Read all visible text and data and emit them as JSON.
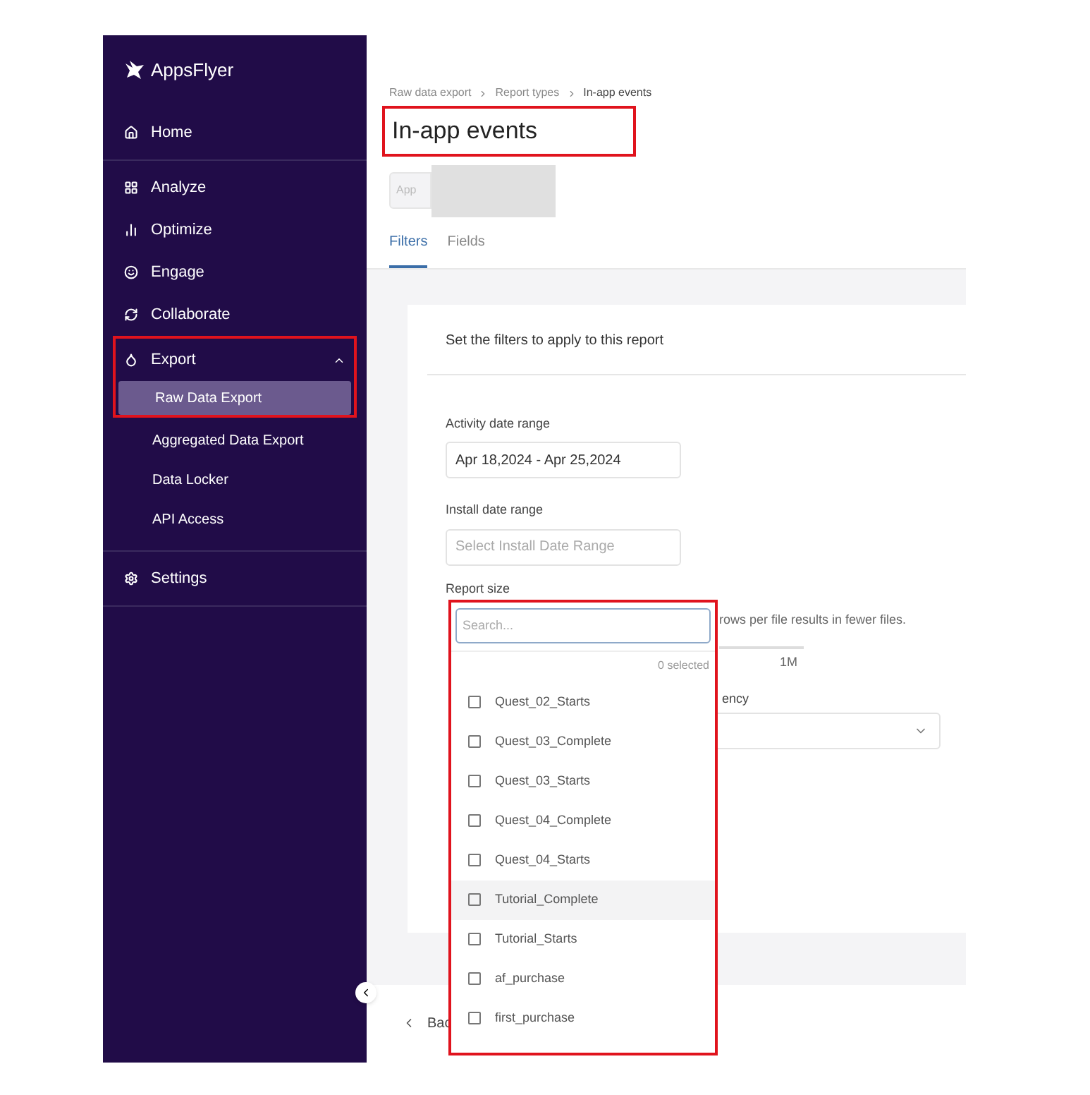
{
  "sidebar": {
    "logo": "AppsFlyer",
    "sections": [
      {
        "items": [
          {
            "label": "Home",
            "selected": false
          }
        ]
      },
      {
        "items": [
          {
            "label": "Analyze",
            "selected": false
          },
          {
            "label": "Optimize",
            "selected": false
          },
          {
            "label": "Engage",
            "selected": false
          },
          {
            "label": "Collaborate",
            "selected": false
          },
          {
            "label": "Export",
            "selected": false,
            "expanded": true,
            "highlighted": true,
            "children": [
              {
                "label": "Raw Data Export",
                "selected": true
              },
              {
                "label": "Aggregated Data Export",
                "selected": false
              },
              {
                "label": "Data Locker",
                "selected": false
              },
              {
                "label": "API Access",
                "selected": false
              }
            ]
          }
        ]
      },
      {
        "items": [
          {
            "label": "Settings",
            "selected": false
          }
        ]
      }
    ]
  },
  "breadcrumb": [
    "Raw data export",
    "Report types",
    "In-app events"
  ],
  "page_title": {
    "text": "In-app events",
    "highlighted": true
  },
  "app_field": {
    "label": "App"
  },
  "tabs": [
    {
      "label": "Filters",
      "selected": true
    },
    {
      "label": "Fields",
      "selected": false
    }
  ],
  "card": {
    "heading": "Set the filters to apply to this report",
    "activity_date_range": {
      "label": "Activity date range",
      "value": "Apr 18,2024 - Apr 25,2024"
    },
    "install_date_range": {
      "label": "Install date range",
      "placeholder": "Select Install Date Range"
    },
    "report_size": {
      "label": "Report size",
      "hint": "rows per file results in fewer files.",
      "tick": "1M"
    },
    "frequency": {
      "label": "ency"
    }
  },
  "footer": {
    "back": "Bac"
  },
  "dropdown": {
    "highlighted": true,
    "search_placeholder": "Search...",
    "count": "0 selected",
    "options": [
      {
        "label": "Quest_02_Starts",
        "checked": false,
        "hovered": false
      },
      {
        "label": "Quest_03_Complete",
        "checked": false,
        "hovered": false
      },
      {
        "label": "Quest_03_Starts",
        "checked": false,
        "hovered": false
      },
      {
        "label": "Quest_04_Complete",
        "checked": false,
        "hovered": false
      },
      {
        "label": "Quest_04_Starts",
        "checked": false,
        "hovered": false
      },
      {
        "label": "Tutorial_Complete",
        "checked": false,
        "hovered": true
      },
      {
        "label": "Tutorial_Starts",
        "checked": false,
        "hovered": false
      },
      {
        "label": "af_purchase",
        "checked": false,
        "hovered": false
      },
      {
        "label": "first_purchase",
        "checked": false,
        "hovered": false
      }
    ]
  }
}
